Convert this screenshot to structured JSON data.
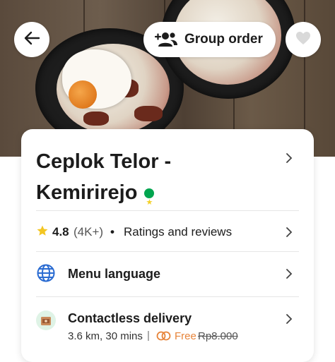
{
  "header": {
    "group_order_label": "Group order",
    "back_icon": "arrow-left-icon",
    "group_icon": "group-people-icon",
    "favorite_icon": "heart-icon"
  },
  "restaurant": {
    "name_line1": "Ceplok Telor -",
    "name_line2": "Kemirirejo",
    "badge_icon": "verified-star-badge-icon"
  },
  "rating": {
    "value": "4.8",
    "count": "(4K+)",
    "separator": "•",
    "link_label": "Ratings and reviews"
  },
  "menu_language": {
    "label": "Menu language",
    "icon": "globe-icon"
  },
  "delivery": {
    "label": "Contactless delivery",
    "distance_time": "3.6 km, 30 mins",
    "separator": "|",
    "fee_label": "Free",
    "original_fee": "Rp8.000",
    "icon": "contactless-delivery-icon"
  },
  "colors": {
    "accent_orange": "#e7843a",
    "badge_green": "#00a54f",
    "star_yellow": "#f3c623",
    "globe_blue": "#2a6bd1"
  }
}
